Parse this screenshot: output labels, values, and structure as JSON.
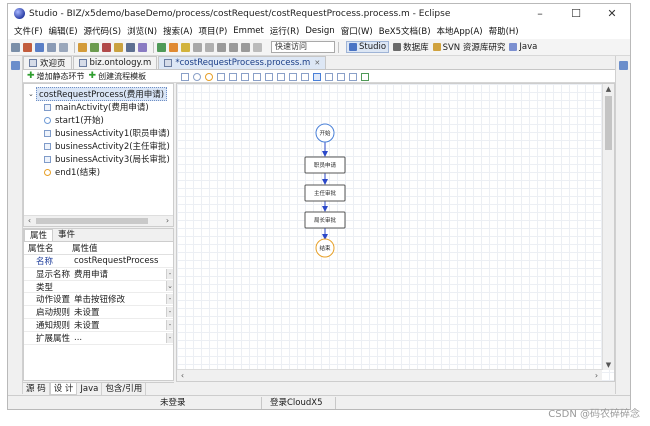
{
  "window": {
    "title": "Studio - BIZ/x5demo/baseDemo/process/costRequest/costRequestProcess.process.m - Eclipse",
    "controls": [
      "–",
      "☐",
      "✕"
    ]
  },
  "menu": [
    "文件(F)",
    "编辑(E)",
    "源代码(S)",
    "浏览(N)",
    "搜索(A)",
    "项目(P)",
    "Emmet",
    "运行(R)",
    "Design",
    "窗口(W)",
    "BeX5文档(B)",
    "本地App(A)",
    "帮助(H)"
  ],
  "toolbar": {
    "quick_access_placeholder": "快速访问",
    "perspectives": [
      {
        "label": "Studio",
        "active": true,
        "icon": "studio-perspective-icon"
      },
      {
        "label": "数据库",
        "active": false,
        "icon": "database-perspective-icon"
      },
      {
        "label": "SVN 资源库研究",
        "active": false,
        "icon": "svn-perspective-icon"
      },
      {
        "label": "Java",
        "active": false,
        "icon": "java-perspective-icon"
      }
    ]
  },
  "editor_tabs": [
    {
      "label": "欢迎页",
      "active": false,
      "closable": false
    },
    {
      "label": "biz.ontology.m",
      "active": false,
      "closable": false
    },
    {
      "label": "*costRequestProcess.process.m",
      "active": true,
      "closable": true
    }
  ],
  "designer_toolbar": {
    "add_static_step": "增加静态环节",
    "create_template": "创建流程模板"
  },
  "outline": {
    "root": "costRequestProcess(费用申请)",
    "items": [
      {
        "label": "mainActivity(费用申请)",
        "icon": "activity-icon"
      },
      {
        "label": "start1(开始)",
        "icon": "start-node-icon"
      },
      {
        "label": "businessActivity1(职员申请)",
        "icon": "activity-icon"
      },
      {
        "label": "businessActivity2(主任审批)",
        "icon": "activity-icon"
      },
      {
        "label": "businessActivity3(局长审批)",
        "icon": "activity-icon"
      },
      {
        "label": "end1(结束)",
        "icon": "end-node-icon"
      }
    ]
  },
  "properties": {
    "tabs": [
      "属性",
      "事件"
    ],
    "header": {
      "name": "属性名",
      "value": "属性值"
    },
    "rows": [
      {
        "name": "名称",
        "value": "costRequestProcess",
        "control": ""
      },
      {
        "name": "显示名称",
        "value": "费用申请",
        "control": "-"
      },
      {
        "name": "类型",
        "value": "",
        "control": "⌄"
      },
      {
        "name": "动作设置",
        "value": "单击按钮修改",
        "control": "-"
      },
      {
        "name": "启动规则",
        "value": "未设置",
        "control": "-"
      },
      {
        "name": "通知规则",
        "value": "未设置",
        "control": "-"
      },
      {
        "name": "扩展属性",
        "value": "...",
        "control": "-"
      }
    ]
  },
  "bottom_tabs": [
    "源 码",
    "设 计",
    "Java",
    "包含/引用"
  ],
  "flow": {
    "start_label": "开始",
    "end_label": "结束",
    "activities": [
      "职员申请",
      "主任审批",
      "局长审批"
    ]
  },
  "status": {
    "login": "未登录",
    "cloud": "登录CloudX5"
  },
  "watermark": "CSDN @码农碎碎念",
  "colors": {
    "accent": "#1b3e87",
    "connector": "#2b48c9",
    "start_node": "#4a80d8",
    "canvas_grid": "#eceff4"
  }
}
